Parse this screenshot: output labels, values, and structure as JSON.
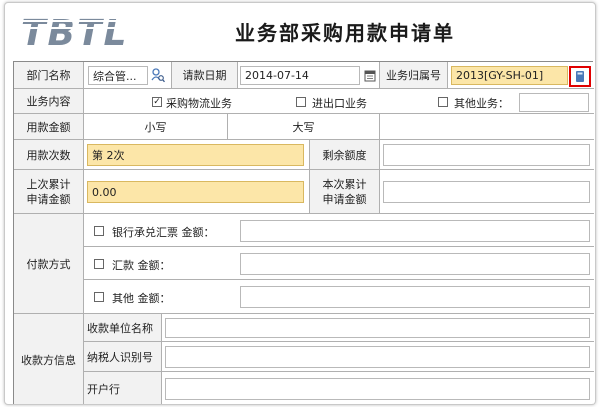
{
  "header": {
    "logo_text": "TBTL",
    "title": "业务部采购用款申请单"
  },
  "row1": {
    "dept_label": "部门名称",
    "dept_value": "综合管...",
    "date_label": "请款日期",
    "date_value": "2014-07-14",
    "business_no_label": "业务归属号",
    "business_no_value": "2013[GY-SH-01]"
  },
  "row2": {
    "content_label": "业务内容",
    "opt1_label": "采购物流业务",
    "opt1_checked": "✓",
    "opt2_label": "进出口业务",
    "opt3_label": "其他业务："
  },
  "row3": {
    "amount_label": "用款金额",
    "lower_label": "小写",
    "upper_label": "大写"
  },
  "row4": {
    "times_label": "用款次数",
    "times_value": "第 2次",
    "remain_label": "剩余额度"
  },
  "row5": {
    "last_total_label": "上次累计\n申请金额",
    "last_total_value": "0.00",
    "this_total_label": "本次累计\n申请金额"
  },
  "payment": {
    "label": "付款方式",
    "opt1_label": "银行承兑汇票  金额：",
    "opt2_label": "汇款  金额：",
    "opt3_label": "其他  金额："
  },
  "payee": {
    "label": "收款方信息",
    "name_label": "收款单位名称",
    "tax_label": "纳税人识别号",
    "bank_label": "开户行"
  },
  "colors": {
    "highlight_input": "#fce6a8",
    "label_bg": "#f2f2f2",
    "callout_border": "#e00000",
    "logo": "#7b8a9c"
  },
  "icons": [
    "person-search-icon",
    "calendar-icon",
    "lookup-icon"
  ]
}
